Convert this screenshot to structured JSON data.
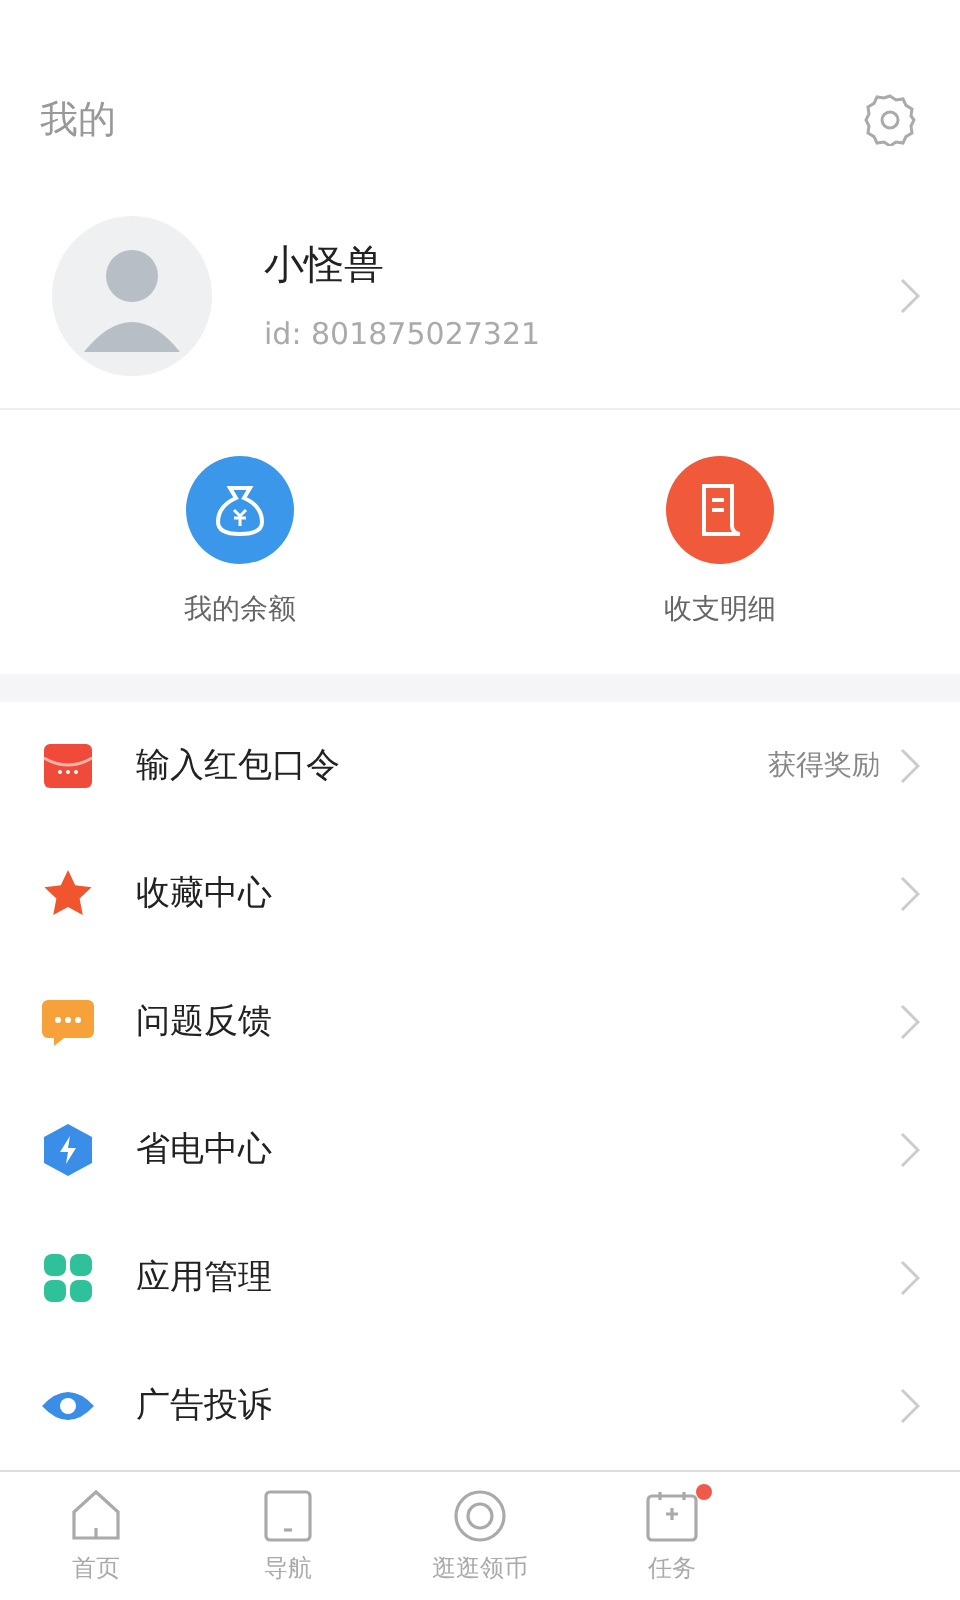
{
  "header": {
    "title": "我的"
  },
  "profile": {
    "name": "小怪兽",
    "id": "id: 801875027321"
  },
  "wallet": [
    {
      "kind": "balance",
      "label": "我的余额"
    },
    {
      "kind": "bill",
      "label": "收支明细"
    }
  ],
  "menu": [
    {
      "kind": "envelope",
      "label": "输入红包口令",
      "hint": "获得奖励"
    },
    {
      "kind": "star",
      "label": "收藏中心"
    },
    {
      "kind": "chat",
      "label": "问题反馈"
    },
    {
      "kind": "power",
      "label": "省电中心"
    },
    {
      "kind": "apps",
      "label": "应用管理"
    },
    {
      "kind": "eye",
      "label": "广告投诉"
    }
  ],
  "tabs": [
    {
      "kind": "home",
      "label": "首页",
      "selected": false,
      "badge": false
    },
    {
      "kind": "nav",
      "label": "导航",
      "selected": false,
      "badge": false
    },
    {
      "kind": "coin",
      "label": "逛逛领币",
      "selected": false,
      "badge": false
    },
    {
      "kind": "task",
      "label": "任务",
      "selected": false,
      "badge": true
    }
  ]
}
